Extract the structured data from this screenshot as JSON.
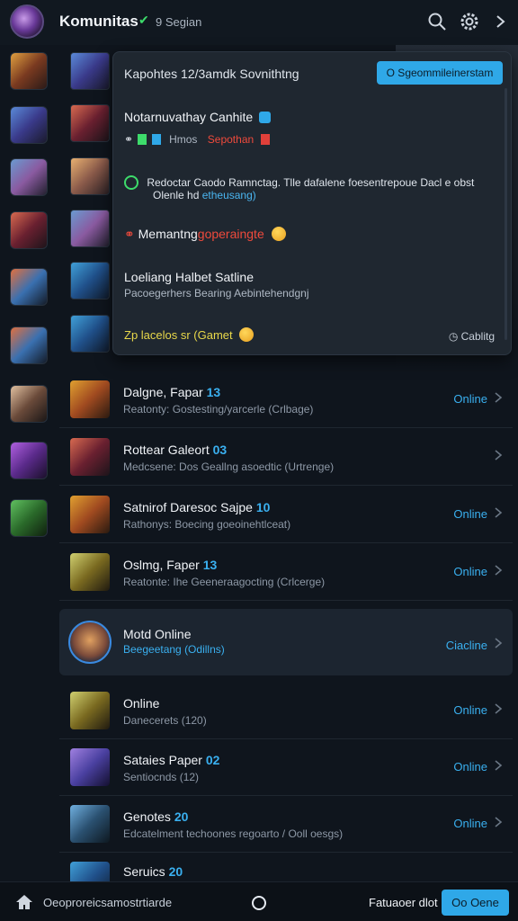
{
  "header": {
    "title": "Komunitas",
    "subtitle": "9 Segian",
    "icons": [
      "search-icon",
      "settings-icon",
      "chevron-right-icon"
    ]
  },
  "panel": {
    "header": "Kapohtes 12/3amdk Sovnithtng",
    "button": "O Sgeommileinerstam",
    "entries": [
      {
        "title": "Notarnuvathay Canhite",
        "meta_a": "Hmos",
        "meta_b": "Sepothan"
      },
      {
        "text": "Redoctar Caodo Ramnctag. Tlle dafalene foesentrepoue Dacl e obst",
        "text2": "Olenle hd",
        "text2_blue": "etheusang)"
      },
      {
        "title": "Memantng",
        "title_red": "goperaingte"
      },
      {
        "title": "Loeliang Halbet Satline",
        "sub": "Pacoegerhers Bearing Aebintehendgnj"
      },
      {
        "yellow": "Zp lacelos sr (Gamet",
        "right": "Cablitg"
      }
    ]
  },
  "rows": [
    {
      "title": "Dalgne, Fapar",
      "num": "13",
      "sub": "Reatonty: Gostesting/yarcerle (Crlbage)",
      "status": "Online"
    },
    {
      "title": "Rottear Galeort",
      "num": "03",
      "sub": "Medcsene: Dos Geallng asoedtic (Urtrenge)",
      "status": ""
    },
    {
      "title": "Satnirof Daresoc Sajpe",
      "num": "10",
      "sub": "Rathonys: Boecing goeoinehtlceat)",
      "status": "Online"
    },
    {
      "title": "Oslmg, Faper",
      "num": "13",
      "sub": "Reatonte: Ihe Geeneraagocting (Crlcerge)",
      "status": "Online"
    }
  ],
  "highlight": {
    "title": "Motd Online",
    "sub": "Beegeetang (Odillns)",
    "status": "Ciacline"
  },
  "rows2": [
    {
      "title": "Online",
      "num": "",
      "sub": "Danecerets (120)",
      "status": "Online"
    },
    {
      "title": "Sataies Paper",
      "num": "02",
      "sub": "Sentiocnds (12)",
      "status": "Online"
    },
    {
      "title": "Genotes",
      "num": "20",
      "sub": "Edcatelment techoones regoarto / Ooll oesgs)",
      "status": "Online"
    },
    {
      "title": "Seruics",
      "num": "20",
      "sub": "",
      "status": ""
    }
  ],
  "bottom": {
    "left_text": "Oeoproreicsamostrtiarde",
    "right_text": "Fatuaoer dlot",
    "button": "Oo Oene"
  },
  "colors": {
    "accent": "#2fa8e8",
    "background": "#0f151d",
    "panel": "#1f2730"
  }
}
